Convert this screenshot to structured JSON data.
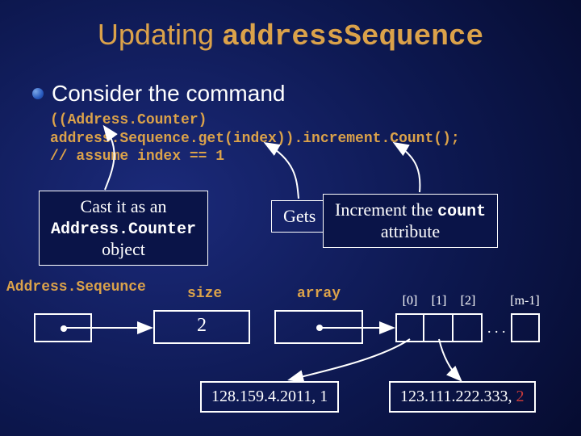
{
  "title": {
    "pre": "Updating ",
    "code": "addressSequence"
  },
  "bullet": "Consider the command",
  "code_lines": [
    "((Address.Counter)",
    "address.Sequence.get(index)).increment.Count();",
    "// assume index == 1"
  ],
  "callouts": {
    "cast_line1": "Cast it as an",
    "cast_line2": "Address.Counter",
    "cast_line3": "object",
    "gets": "Gets ",
    "inc_line1_pre": "Increment the ",
    "inc_line1_code": "count",
    "inc_line2": "attribute"
  },
  "labels": {
    "seq": "Address.Seqeunce",
    "size": "size",
    "array": "array"
  },
  "values": {
    "size": "2"
  },
  "array": {
    "indices": [
      "[0]",
      "[1]",
      "[2]",
      "[m-1]"
    ],
    "ellipsis": ". . ."
  },
  "ips": {
    "first": "128.159.4.2011, 1",
    "second_pre": "123.111.222.333, ",
    "second_num": "2"
  }
}
